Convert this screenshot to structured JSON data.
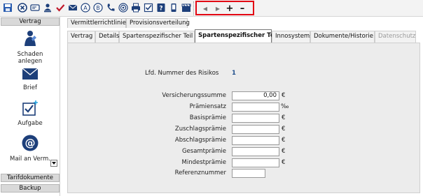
{
  "toolbar": {
    "icons": [
      "save-icon",
      "cancel-icon",
      "message-icon",
      "user-stamp-icon",
      "checkmark-icon",
      "mail-icon",
      "letter-a-icon",
      "letter-b-icon",
      "phone-icon",
      "target-icon",
      "printer-icon",
      "checklist-icon",
      "help-icon",
      "mobile-icon",
      "clapper-icon"
    ],
    "nav": {
      "first": "◀",
      "next": "▶",
      "plus": "+",
      "minus": "–"
    },
    "nav_highlight_color": "#e30613"
  },
  "sidebar": {
    "header": "Vertrag",
    "items": [
      {
        "label": "Schaden anlegen",
        "icon": "damage-report-icon"
      },
      {
        "label": "Brief",
        "icon": "envelope-icon"
      },
      {
        "label": "Aufgabe",
        "icon": "task-checkbox-icon"
      },
      {
        "label": "Mail an Verm.",
        "icon": "at-sign-icon"
      }
    ],
    "footer_buttons": [
      "Tarifdokumente",
      "Backup"
    ]
  },
  "tabs_top": [
    "Vermittlerrichtlinie",
    "Provisionsverteilung"
  ],
  "tabs": [
    {
      "label": "Vertrag",
      "state": "normal"
    },
    {
      "label": "Details",
      "state": "normal"
    },
    {
      "label": "Spartenspezifischer Teil I",
      "state": "normal"
    },
    {
      "label": "Spartenspezifischer Teil II",
      "state": "active"
    },
    {
      "label": "Innosystems",
      "state": "normal"
    },
    {
      "label": "Dokumente/Historie",
      "state": "normal"
    },
    {
      "label": "Datenschutz",
      "state": "disabled"
    }
  ],
  "form": {
    "risk_number_label": "Lfd. Nummer des Risikos",
    "risk_number_value": "1",
    "fields": [
      {
        "label": "Versicherungssumme",
        "value": "0,00",
        "unit": "€"
      },
      {
        "label": "Prämiensatz",
        "value": "",
        "unit": "‰"
      },
      {
        "label": "Basisprämie",
        "value": "",
        "unit": "€"
      },
      {
        "label": "Zuschlagsprämie",
        "value": "",
        "unit": "€"
      },
      {
        "label": "Abschlagsprämie",
        "value": "",
        "unit": "€"
      },
      {
        "label": "Gesamtprämie",
        "value": "",
        "unit": "€"
      },
      {
        "label": "Mindestprämie",
        "value": "",
        "unit": "€"
      },
      {
        "label": "Referenznummer",
        "value": "",
        "unit": ""
      }
    ]
  }
}
